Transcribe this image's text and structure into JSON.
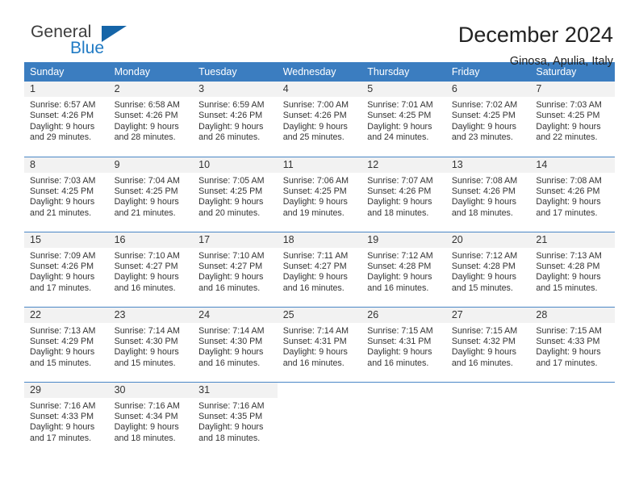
{
  "brand": {
    "name_part1": "General",
    "name_part2": "Blue",
    "triangle_color": "#1565a8",
    "blue_text_color": "#1f7ac4"
  },
  "header": {
    "title": "December 2024",
    "subtitle": "Ginosa, Apulia, Italy"
  },
  "theme": {
    "header_blue": "#3b7dc0",
    "row_rule_blue": "#4a87c6",
    "daynum_background": "#f2f2f2"
  },
  "weekdays": [
    "Sunday",
    "Monday",
    "Tuesday",
    "Wednesday",
    "Thursday",
    "Friday",
    "Saturday"
  ],
  "weeks": [
    [
      {
        "day": "1",
        "sunrise": "Sunrise: 6:57 AM",
        "sunset": "Sunset: 4:26 PM",
        "daylight1": "Daylight: 9 hours",
        "daylight2": "and 29 minutes."
      },
      {
        "day": "2",
        "sunrise": "Sunrise: 6:58 AM",
        "sunset": "Sunset: 4:26 PM",
        "daylight1": "Daylight: 9 hours",
        "daylight2": "and 28 minutes."
      },
      {
        "day": "3",
        "sunrise": "Sunrise: 6:59 AM",
        "sunset": "Sunset: 4:26 PM",
        "daylight1": "Daylight: 9 hours",
        "daylight2": "and 26 minutes."
      },
      {
        "day": "4",
        "sunrise": "Sunrise: 7:00 AM",
        "sunset": "Sunset: 4:26 PM",
        "daylight1": "Daylight: 9 hours",
        "daylight2": "and 25 minutes."
      },
      {
        "day": "5",
        "sunrise": "Sunrise: 7:01 AM",
        "sunset": "Sunset: 4:25 PM",
        "daylight1": "Daylight: 9 hours",
        "daylight2": "and 24 minutes."
      },
      {
        "day": "6",
        "sunrise": "Sunrise: 7:02 AM",
        "sunset": "Sunset: 4:25 PM",
        "daylight1": "Daylight: 9 hours",
        "daylight2": "and 23 minutes."
      },
      {
        "day": "7",
        "sunrise": "Sunrise: 7:03 AM",
        "sunset": "Sunset: 4:25 PM",
        "daylight1": "Daylight: 9 hours",
        "daylight2": "and 22 minutes."
      }
    ],
    [
      {
        "day": "8",
        "sunrise": "Sunrise: 7:03 AM",
        "sunset": "Sunset: 4:25 PM",
        "daylight1": "Daylight: 9 hours",
        "daylight2": "and 21 minutes."
      },
      {
        "day": "9",
        "sunrise": "Sunrise: 7:04 AM",
        "sunset": "Sunset: 4:25 PM",
        "daylight1": "Daylight: 9 hours",
        "daylight2": "and 21 minutes."
      },
      {
        "day": "10",
        "sunrise": "Sunrise: 7:05 AM",
        "sunset": "Sunset: 4:25 PM",
        "daylight1": "Daylight: 9 hours",
        "daylight2": "and 20 minutes."
      },
      {
        "day": "11",
        "sunrise": "Sunrise: 7:06 AM",
        "sunset": "Sunset: 4:25 PM",
        "daylight1": "Daylight: 9 hours",
        "daylight2": "and 19 minutes."
      },
      {
        "day": "12",
        "sunrise": "Sunrise: 7:07 AM",
        "sunset": "Sunset: 4:26 PM",
        "daylight1": "Daylight: 9 hours",
        "daylight2": "and 18 minutes."
      },
      {
        "day": "13",
        "sunrise": "Sunrise: 7:08 AM",
        "sunset": "Sunset: 4:26 PM",
        "daylight1": "Daylight: 9 hours",
        "daylight2": "and 18 minutes."
      },
      {
        "day": "14",
        "sunrise": "Sunrise: 7:08 AM",
        "sunset": "Sunset: 4:26 PM",
        "daylight1": "Daylight: 9 hours",
        "daylight2": "and 17 minutes."
      }
    ],
    [
      {
        "day": "15",
        "sunrise": "Sunrise: 7:09 AM",
        "sunset": "Sunset: 4:26 PM",
        "daylight1": "Daylight: 9 hours",
        "daylight2": "and 17 minutes."
      },
      {
        "day": "16",
        "sunrise": "Sunrise: 7:10 AM",
        "sunset": "Sunset: 4:27 PM",
        "daylight1": "Daylight: 9 hours",
        "daylight2": "and 16 minutes."
      },
      {
        "day": "17",
        "sunrise": "Sunrise: 7:10 AM",
        "sunset": "Sunset: 4:27 PM",
        "daylight1": "Daylight: 9 hours",
        "daylight2": "and 16 minutes."
      },
      {
        "day": "18",
        "sunrise": "Sunrise: 7:11 AM",
        "sunset": "Sunset: 4:27 PM",
        "daylight1": "Daylight: 9 hours",
        "daylight2": "and 16 minutes."
      },
      {
        "day": "19",
        "sunrise": "Sunrise: 7:12 AM",
        "sunset": "Sunset: 4:28 PM",
        "daylight1": "Daylight: 9 hours",
        "daylight2": "and 16 minutes."
      },
      {
        "day": "20",
        "sunrise": "Sunrise: 7:12 AM",
        "sunset": "Sunset: 4:28 PM",
        "daylight1": "Daylight: 9 hours",
        "daylight2": "and 15 minutes."
      },
      {
        "day": "21",
        "sunrise": "Sunrise: 7:13 AM",
        "sunset": "Sunset: 4:28 PM",
        "daylight1": "Daylight: 9 hours",
        "daylight2": "and 15 minutes."
      }
    ],
    [
      {
        "day": "22",
        "sunrise": "Sunrise: 7:13 AM",
        "sunset": "Sunset: 4:29 PM",
        "daylight1": "Daylight: 9 hours",
        "daylight2": "and 15 minutes."
      },
      {
        "day": "23",
        "sunrise": "Sunrise: 7:14 AM",
        "sunset": "Sunset: 4:30 PM",
        "daylight1": "Daylight: 9 hours",
        "daylight2": "and 15 minutes."
      },
      {
        "day": "24",
        "sunrise": "Sunrise: 7:14 AM",
        "sunset": "Sunset: 4:30 PM",
        "daylight1": "Daylight: 9 hours",
        "daylight2": "and 16 minutes."
      },
      {
        "day": "25",
        "sunrise": "Sunrise: 7:14 AM",
        "sunset": "Sunset: 4:31 PM",
        "daylight1": "Daylight: 9 hours",
        "daylight2": "and 16 minutes."
      },
      {
        "day": "26",
        "sunrise": "Sunrise: 7:15 AM",
        "sunset": "Sunset: 4:31 PM",
        "daylight1": "Daylight: 9 hours",
        "daylight2": "and 16 minutes."
      },
      {
        "day": "27",
        "sunrise": "Sunrise: 7:15 AM",
        "sunset": "Sunset: 4:32 PM",
        "daylight1": "Daylight: 9 hours",
        "daylight2": "and 16 minutes."
      },
      {
        "day": "28",
        "sunrise": "Sunrise: 7:15 AM",
        "sunset": "Sunset: 4:33 PM",
        "daylight1": "Daylight: 9 hours",
        "daylight2": "and 17 minutes."
      }
    ],
    [
      {
        "day": "29",
        "sunrise": "Sunrise: 7:16 AM",
        "sunset": "Sunset: 4:33 PM",
        "daylight1": "Daylight: 9 hours",
        "daylight2": "and 17 minutes."
      },
      {
        "day": "30",
        "sunrise": "Sunrise: 7:16 AM",
        "sunset": "Sunset: 4:34 PM",
        "daylight1": "Daylight: 9 hours",
        "daylight2": "and 18 minutes."
      },
      {
        "day": "31",
        "sunrise": "Sunrise: 7:16 AM",
        "sunset": "Sunset: 4:35 PM",
        "daylight1": "Daylight: 9 hours",
        "daylight2": "and 18 minutes."
      },
      {
        "day": "",
        "sunrise": "",
        "sunset": "",
        "daylight1": "",
        "daylight2": ""
      },
      {
        "day": "",
        "sunrise": "",
        "sunset": "",
        "daylight1": "",
        "daylight2": ""
      },
      {
        "day": "",
        "sunrise": "",
        "sunset": "",
        "daylight1": "",
        "daylight2": ""
      },
      {
        "day": "",
        "sunrise": "",
        "sunset": "",
        "daylight1": "",
        "daylight2": ""
      }
    ]
  ]
}
